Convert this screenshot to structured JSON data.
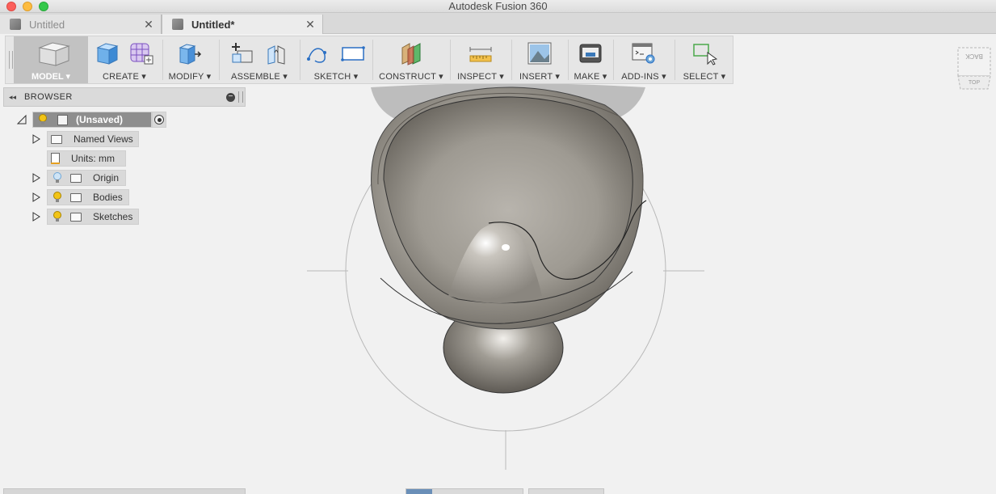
{
  "window": {
    "title": "Autodesk Fusion 360"
  },
  "tabs": [
    {
      "label": "Untitled",
      "active": false,
      "close": "✕"
    },
    {
      "label": "Untitled*",
      "active": true,
      "close": "✕"
    }
  ],
  "toolbar": {
    "workspace": "MODEL ▾",
    "groups": [
      {
        "label": "CREATE ▾",
        "icons": [
          "box-icon",
          "form-icon"
        ]
      },
      {
        "label": "MODIFY ▾",
        "icons": [
          "press-pull-icon"
        ]
      },
      {
        "label": "ASSEMBLE ▾",
        "icons": [
          "new-component-icon",
          "joint-icon"
        ]
      },
      {
        "label": "SKETCH ▾",
        "icons": [
          "spline-icon",
          "rectangle-icon"
        ]
      },
      {
        "label": "CONSTRUCT ▾",
        "icons": [
          "offset-plane-icon"
        ]
      },
      {
        "label": "INSPECT ▾",
        "icons": [
          "measure-icon"
        ]
      },
      {
        "label": "INSERT ▾",
        "icons": [
          "insert-image-icon"
        ]
      },
      {
        "label": "MAKE ▾",
        "icons": [
          "print-3d-icon"
        ]
      },
      {
        "label": "ADD-INS ▾",
        "icons": [
          "scripts-icon"
        ]
      },
      {
        "label": "SELECT ▾",
        "icons": [
          "select-icon"
        ]
      }
    ]
  },
  "browser": {
    "title": "BROWSER",
    "collapse_glyph": "◂◂",
    "minus_glyph": "−",
    "root": {
      "label": "(Unsaved)"
    },
    "items": [
      {
        "label": "Named Views",
        "expandable": true,
        "bulb": false,
        "icon": "folder"
      },
      {
        "label": "Units: mm",
        "expandable": false,
        "bulb": false,
        "icon": "document"
      },
      {
        "label": "Origin",
        "expandable": true,
        "bulb": "blue",
        "icon": "folder"
      },
      {
        "label": "Bodies",
        "expandable": true,
        "bulb": "yellow",
        "icon": "folder"
      },
      {
        "label": "Sketches",
        "expandable": true,
        "bulb": "yellow",
        "icon": "folder"
      }
    ]
  },
  "viewcube": {
    "face_top": "BACK",
    "face_bottom": "TOP"
  },
  "colors": {
    "workspace_bg": "#c2c2c2",
    "bulb_yellow": "#f2c417",
    "bulb_blue": "#6fa8d8",
    "viewport_bg": "#f1f1f1"
  }
}
